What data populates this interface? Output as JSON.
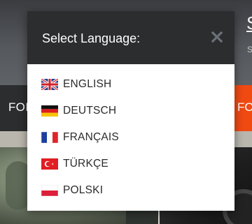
{
  "background": {
    "header_letter": "S",
    "header_small": "S",
    "nav_left_label": "FOI",
    "nav_right_label": "FO"
  },
  "modal": {
    "title": "Select Language:",
    "close_icon": "close-icon"
  },
  "languages": [
    {
      "label": "ENGLISH",
      "flag": "uk-flag-icon"
    },
    {
      "label": "DEUTSCH",
      "flag": "germany-flag-icon"
    },
    {
      "label": "FRANÇAIS",
      "flag": "france-flag-icon"
    },
    {
      "label": "TÜRKÇE",
      "flag": "turkey-flag-icon"
    },
    {
      "label": "POLSKI",
      "flag": "poland-flag-icon"
    }
  ],
  "colors": {
    "modal_header": "#2b2d2f",
    "accent_orange": "#f04a13",
    "close_icon": "#6b7177"
  }
}
